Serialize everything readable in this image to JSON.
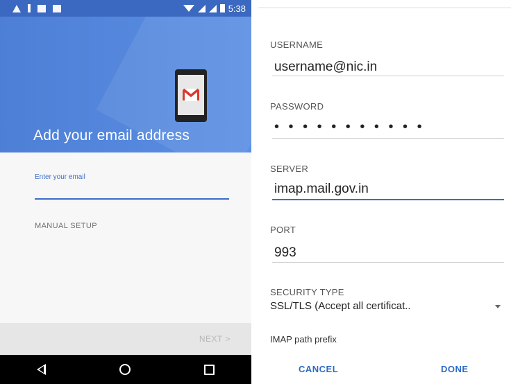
{
  "left_screen": {
    "status_bar": {
      "time": "5:38",
      "icons": [
        "notification-icon",
        "wifi-icon",
        "signal-icon",
        "battery-icon"
      ]
    },
    "header": {
      "title": "Add your email address",
      "logo": "gmail-logo"
    },
    "email_field": {
      "label": "Enter your email",
      "value": ""
    },
    "manual_setup": "MANUAL SETUP",
    "next_button": "NEXT >",
    "nav": [
      "back-icon",
      "home-icon",
      "recents-icon"
    ],
    "colors": {
      "header": "#4d7fd6",
      "accent": "#3b6cc9",
      "navbar": "#000000"
    }
  },
  "right_screen": {
    "username": {
      "label": "USERNAME",
      "value": "username@nic.in"
    },
    "password": {
      "label": "PASSWORD",
      "value": "• • • • • • • • • • •"
    },
    "server": {
      "label": "SERVER",
      "value": "imap.mail.gov.in"
    },
    "port": {
      "label": "PORT",
      "value": "993"
    },
    "security_type": {
      "label": "SECURITY TYPE",
      "value": "SSL/TLS (Accept all certificat.."
    },
    "imap_path_prefix": "IMAP path prefix",
    "cancel_button": "CANCEL",
    "done_button": "DONE",
    "colors": {
      "accent": "#2c6cc4"
    }
  }
}
